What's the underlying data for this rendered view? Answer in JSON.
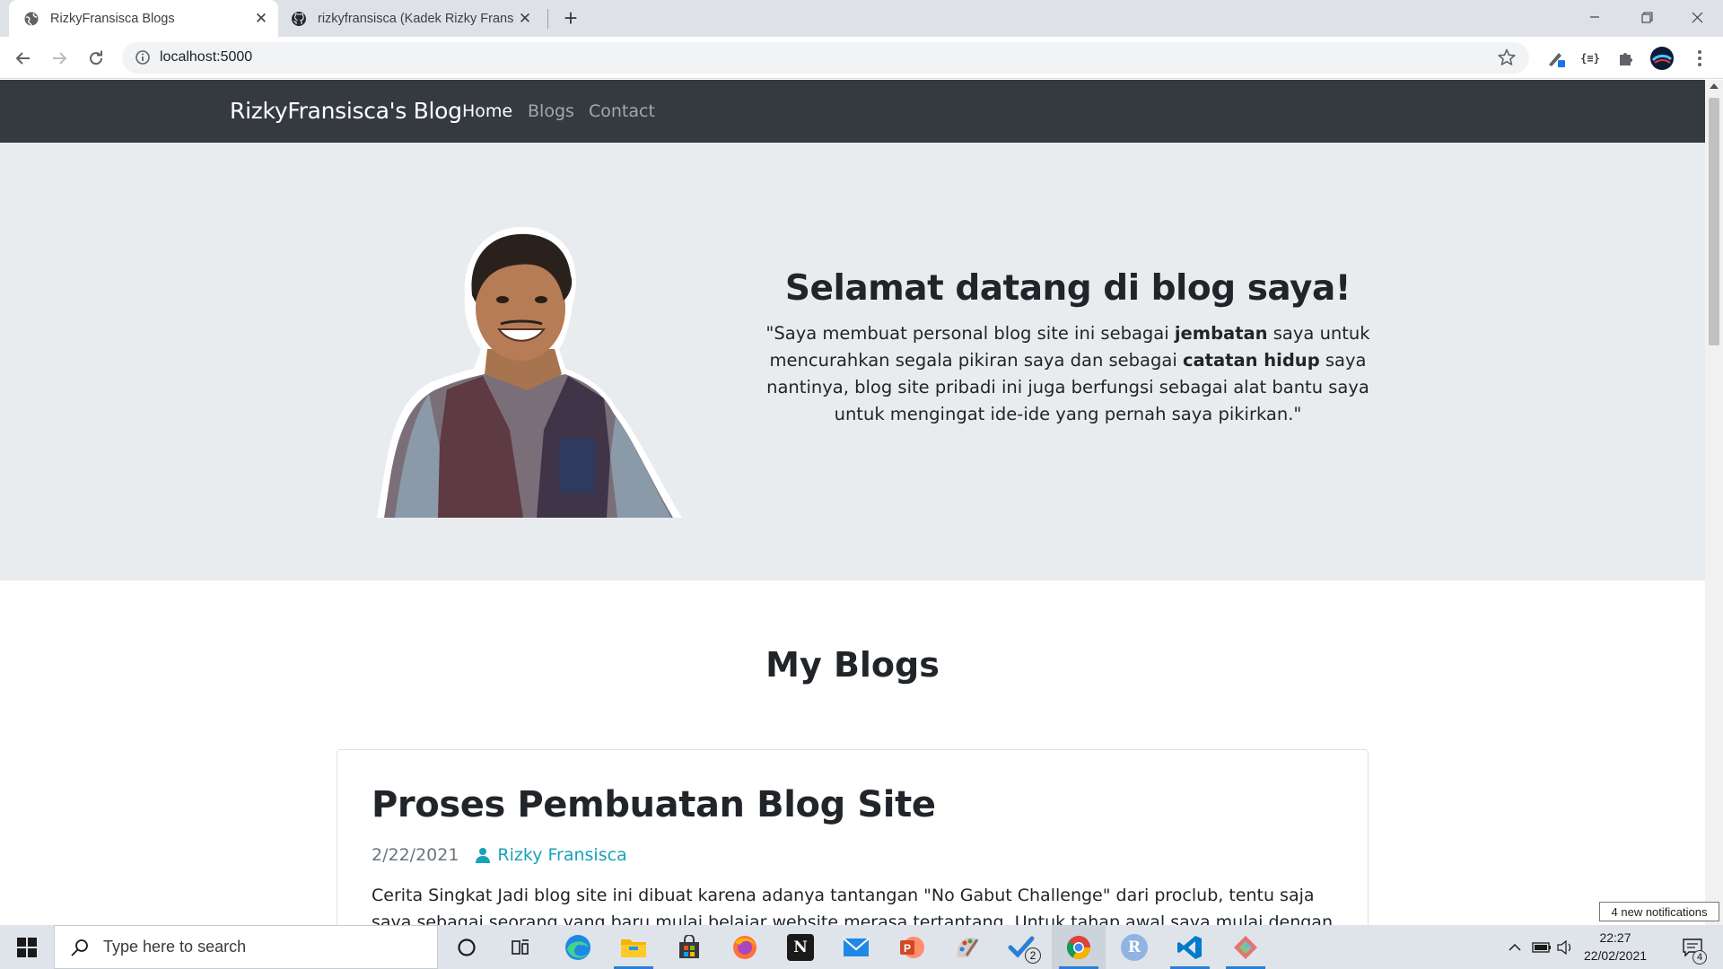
{
  "browser": {
    "tabs": [
      {
        "title": "RizkyFransisca Blogs",
        "active": true
      },
      {
        "title": "rizkyfransisca (Kadek Rizky Fransisca)",
        "active": false
      }
    ],
    "url": "localhost:5000"
  },
  "site": {
    "brand": "RizkyFransisca's Blog",
    "nav": [
      {
        "label": "Home",
        "active": true
      },
      {
        "label": "Blogs",
        "active": false
      },
      {
        "label": "Contact",
        "active": false
      }
    ],
    "hero": {
      "title": "Selamat datang di blog saya!",
      "quote_parts": [
        {
          "text": "\"Saya membuat personal blog site ini sebagai ",
          "bold": false
        },
        {
          "text": "jembatan",
          "bold": true
        },
        {
          "text": " saya untuk mencurahkan segala pikiran saya dan sebagai ",
          "bold": false
        },
        {
          "text": "catatan hidup",
          "bold": true
        },
        {
          "text": " saya nantinya, blog site pribadi ini juga berfungsi sebagai alat bantu saya untuk mengingat ide-ide yang pernah saya pikirkan.\"",
          "bold": false
        }
      ]
    },
    "section_title": "My Blogs",
    "posts": [
      {
        "title": "Proses Pembuatan Blog Site",
        "date": "2/22/2021",
        "author": "Rizky Fransisca",
        "excerpt": "Cerita Singkat Jadi blog site ini dibuat karena adanya tantangan \"No Gabut Challenge\" dari proclub, tentu saja saya sebagai seorang yang baru mulai belajar website merasa tertantang. Untuk tahap awal saya mulai dengan pemilihan"
      }
    ]
  },
  "notification_tip": "4 new notifications",
  "taskbar": {
    "search_placeholder": "Type here to search",
    "time": "22:27",
    "date": "22/02/2021",
    "todo_badge": "2",
    "action_center_badge": "4",
    "apps": [
      "cortana-icon",
      "task-view-icon",
      "edge-icon",
      "file-explorer-icon",
      "store-icon",
      "firefox-icon",
      "notion-icon",
      "mail-icon",
      "powerpoint-icon",
      "paint-icon",
      "todo-icon",
      "chrome-icon",
      "r-icon",
      "vscode-icon",
      "git-icon"
    ]
  },
  "colors": {
    "navbar": "#343a40",
    "hero_bg": "#e9ecef",
    "link_accent": "#17a2b8",
    "muted_text": "#6c757d"
  }
}
